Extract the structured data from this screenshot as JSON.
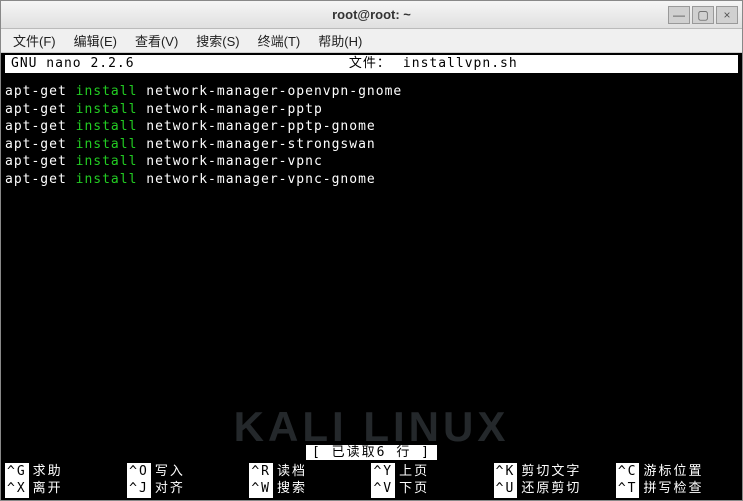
{
  "window": {
    "title": "root@root: ~",
    "minimize": "—",
    "maximize": "▢",
    "close": "×"
  },
  "menubar": [
    "文件(F)",
    "编辑(E)",
    "查看(V)",
    "搜索(S)",
    "终端(T)",
    "帮助(H)"
  ],
  "nano": {
    "version": "GNU nano 2.2.6",
    "file_label": "文件：",
    "filename": "installvpn.sh"
  },
  "editor_lines": [
    {
      "cmd": "apt-get ",
      "kw": "install",
      "rest": " network-manager-openvpn-gnome"
    },
    {
      "cmd": "apt-get ",
      "kw": "install",
      "rest": " network-manager-pptp"
    },
    {
      "cmd": "apt-get ",
      "kw": "install",
      "rest": " network-manager-pptp-gnome"
    },
    {
      "cmd": "apt-get ",
      "kw": "install",
      "rest": " network-manager-strongswan"
    },
    {
      "cmd": "apt-get ",
      "kw": "install",
      "rest": " network-manager-vpnc"
    },
    {
      "cmd": "apt-get ",
      "kw": "install",
      "rest": " network-manager-vpnc-gnome"
    }
  ],
  "status": "[ 已读取6 行 ]",
  "shortcuts_row1": [
    {
      "key": "^G",
      "label": "求助"
    },
    {
      "key": "^O",
      "label": "写入"
    },
    {
      "key": "^R",
      "label": "读档"
    },
    {
      "key": "^Y",
      "label": "上页"
    },
    {
      "key": "^K",
      "label": "剪切文字"
    },
    {
      "key": "^C",
      "label": "游标位置"
    }
  ],
  "shortcuts_row2": [
    {
      "key": "^X",
      "label": "离开"
    },
    {
      "key": "^J",
      "label": "对齐"
    },
    {
      "key": "^W",
      "label": "搜索"
    },
    {
      "key": "^V",
      "label": "下页"
    },
    {
      "key": "^U",
      "label": "还原剪切"
    },
    {
      "key": "^T",
      "label": "拼写检查"
    }
  ],
  "watermark": "KALI LINUX"
}
